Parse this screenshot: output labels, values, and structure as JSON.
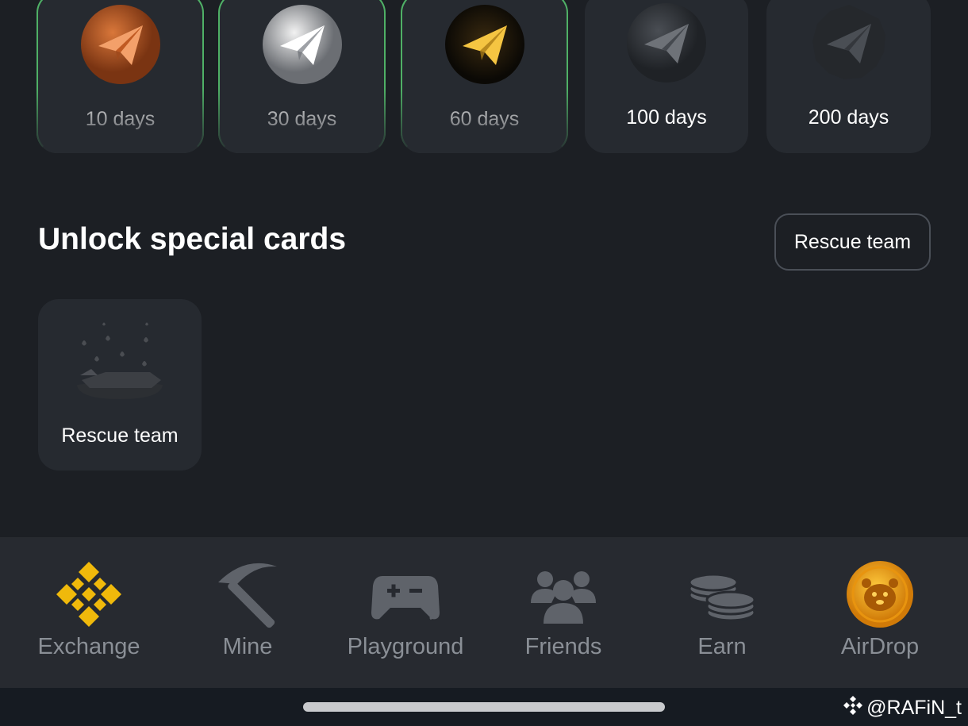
{
  "streak": {
    "items": [
      {
        "label": "10 days",
        "icon": "bronze-plane-icon"
      },
      {
        "label": "30 days",
        "icon": "silver-plane-icon"
      },
      {
        "label": "60 days",
        "icon": "gold-plane-icon"
      },
      {
        "label": "100 days",
        "icon": "platinum-plane-icon"
      },
      {
        "label": "200 days",
        "icon": "diamond-plane-icon"
      }
    ]
  },
  "special": {
    "title": "Unlock special cards",
    "filter_label": "Rescue team",
    "cards": [
      {
        "label": "Rescue team",
        "icon": "rescue-team-spaceship-icon"
      }
    ]
  },
  "nav": {
    "items": [
      {
        "label": "Exchange",
        "icon": "binance-icon",
        "active": true
      },
      {
        "label": "Mine",
        "icon": "pickaxe-icon"
      },
      {
        "label": "Playground",
        "icon": "gamepad-icon"
      },
      {
        "label": "Friends",
        "icon": "friends-icon"
      },
      {
        "label": "Earn",
        "icon": "coins-icon"
      },
      {
        "label": "AirDrop",
        "icon": "hamster-coin-icon"
      }
    ]
  },
  "watermark": "@RAFiN_t",
  "colors": {
    "background": "#1c1f24",
    "card": "#262a30",
    "accent_green": "#4fb066",
    "binance_yellow": "#f0b90b",
    "nav_inactive": "#8a8f96"
  }
}
